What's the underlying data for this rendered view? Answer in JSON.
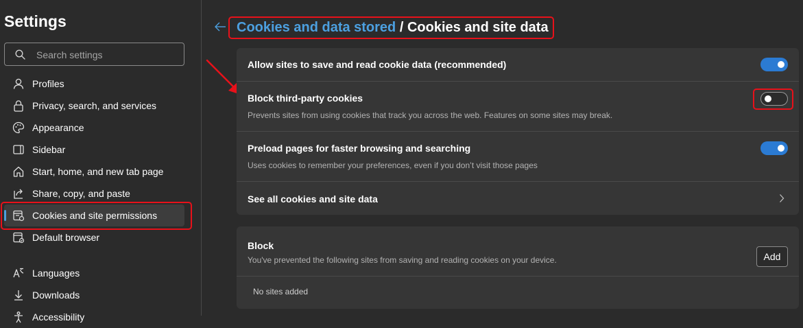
{
  "sidebar": {
    "title": "Settings",
    "search": {
      "placeholder": "Search settings",
      "value": ""
    },
    "items": [
      {
        "label": "Profiles",
        "icon": "profile-icon"
      },
      {
        "label": "Privacy, search, and services",
        "icon": "lock-icon"
      },
      {
        "label": "Appearance",
        "icon": "appearance-icon"
      },
      {
        "label": "Sidebar",
        "icon": "sidebar-icon"
      },
      {
        "label": "Start, home, and new tab page",
        "icon": "home-icon"
      },
      {
        "label": "Share, copy, and paste",
        "icon": "share-icon"
      },
      {
        "label": "Cookies and site permissions",
        "icon": "cookies-permissions-icon",
        "active": true
      },
      {
        "label": "Default browser",
        "icon": "browser-icon"
      },
      {
        "label": "Languages",
        "icon": "languages-icon"
      },
      {
        "label": "Downloads",
        "icon": "download-icon"
      },
      {
        "label": "Accessibility",
        "icon": "accessibility-icon"
      }
    ]
  },
  "main": {
    "breadcrumb": {
      "parent": "Cookies and data stored",
      "separator": " / ",
      "current": "Cookies and site data"
    },
    "settings": [
      {
        "title": "Allow sites to save and read cookie data (recommended)",
        "description": "",
        "toggle": true
      },
      {
        "title": "Block third-party cookies",
        "description": "Prevents sites from using cookies that track you across the web. Features on some sites may break.",
        "toggle": false
      },
      {
        "title": "Preload pages for faster browsing and searching",
        "description": "Uses cookies to remember your preferences, even if you don’t visit those pages",
        "toggle": true
      },
      {
        "title": "See all cookies and site data",
        "description": "",
        "link": true
      }
    ],
    "block": {
      "title": "Block",
      "description": "You've prevented the following sites from saving and reading cookies on your device.",
      "add_label": "Add",
      "empty_text": "No sites added"
    }
  },
  "colors": {
    "accent": "#4ca0e0",
    "toggle_on": "#2b7bd3",
    "highlight": "#e8111a",
    "background": "#2b2b2b",
    "card": "#363636"
  }
}
